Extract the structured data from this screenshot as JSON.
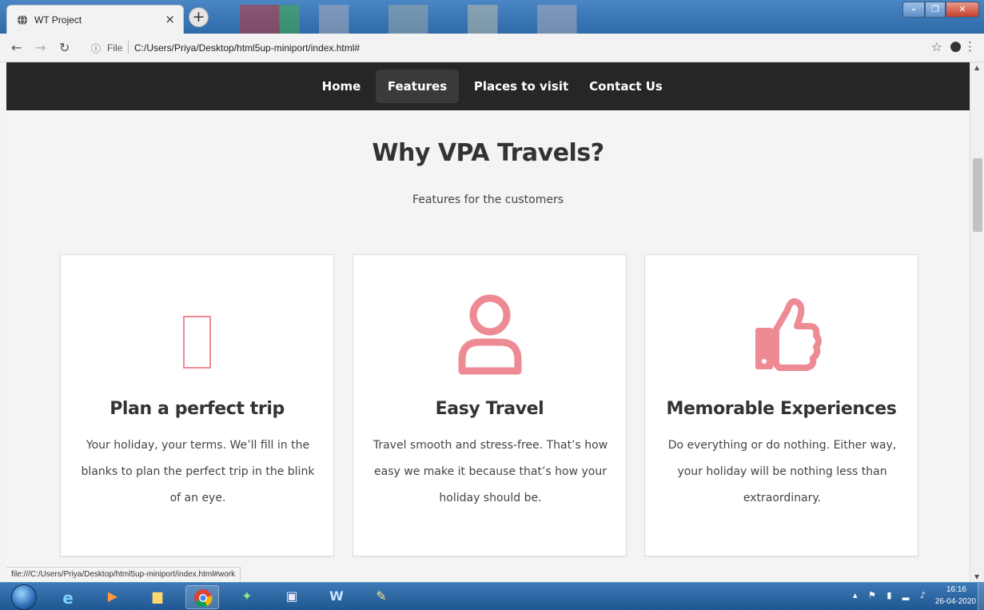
{
  "browser": {
    "tab_title": "WT Project",
    "tab_close": "×",
    "new_tab": "+",
    "address_scheme": "File",
    "address_url": "C:/Users/Priya/Desktop/html5up-miniport/index.html#",
    "status_url": "file:///C:/Users/Priya/Desktop/html5up-miniport/index.html#work"
  },
  "site_nav": {
    "items": [
      {
        "label": "Home"
      },
      {
        "label": "Features"
      },
      {
        "label": "Places to visit"
      },
      {
        "label": "Contact Us"
      }
    ]
  },
  "section": {
    "title": "Why VPA Travels?",
    "subtitle": "Features for the customers"
  },
  "cards": [
    {
      "icon": "missing-glyph-icon",
      "title": "Plan a perfect trip",
      "text": "Your holiday, your terms. We’ll fill in the blanks to plan the perfect trip in the blink of an eye."
    },
    {
      "icon": "user-icon",
      "title": "Easy Travel",
      "text": "Travel smooth and stress-free. That’s how easy we make it because that’s how your holiday should be."
    },
    {
      "icon": "thumbs-up-icon",
      "title": "Memorable Experiences",
      "text": "Do everything or do nothing. Either way, your holiday will be nothing less than extraordinary."
    }
  ],
  "taskbar": {
    "time": "16:16",
    "date": "26-04-2020"
  },
  "colors": {
    "accent": "#ee8a94",
    "nav_bg": "#262626",
    "page_bg": "#f4f4f4"
  }
}
